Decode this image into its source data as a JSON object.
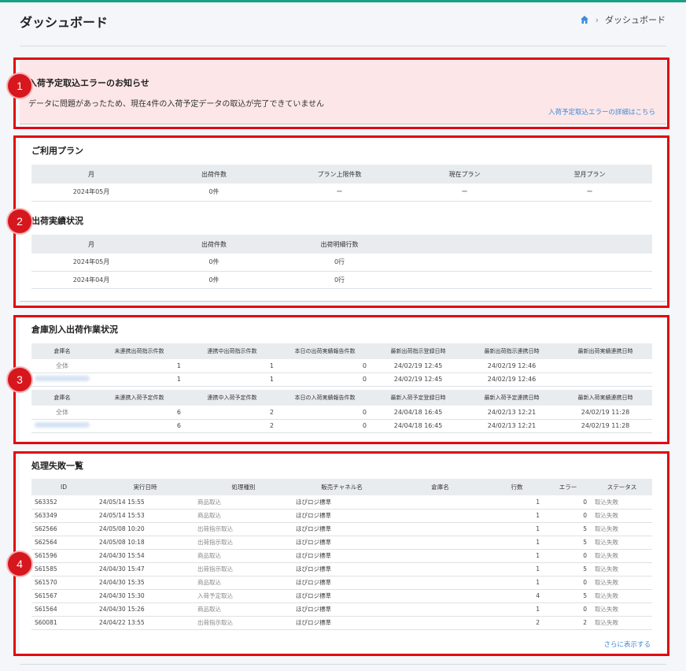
{
  "header": {
    "title": "ダッシュボード",
    "breadcrumb_sep": "›",
    "breadcrumb_current": "ダッシュボード"
  },
  "markers": [
    "1",
    "2",
    "3",
    "4"
  ],
  "alert": {
    "title": "入荷予定取込エラーのお知らせ",
    "message": "データに問題があったため、現在4件の入荷予定データの取込が完了できていません",
    "link": "入荷予定取込エラーの詳細はこちら"
  },
  "plan": {
    "title": "ご利用プラン",
    "headers": [
      "月",
      "出荷件数",
      "プラン上限件数",
      "現在プラン",
      "翌月プラン"
    ],
    "rows": [
      [
        "2024年05月",
        "0件",
        "ー",
        "ー",
        "ー"
      ]
    ]
  },
  "shipment": {
    "title": "出荷実績状況",
    "headers": [
      "月",
      "出荷件数",
      "出荷明細行数"
    ],
    "rows": [
      [
        "2024年05月",
        "0件",
        "0行"
      ],
      [
        "2024年04月",
        "0件",
        "0行"
      ]
    ]
  },
  "warehouse": {
    "title": "倉庫別入出荷作業状況",
    "out_headers": [
      "倉庫名",
      "未連携出荷指示件数",
      "連携中出荷指示件数",
      "本日の出荷実績報告件数",
      "最新出荷指示登録日時",
      "最新出荷指示連携日時",
      "最新出荷実績連携日時"
    ],
    "out_rows": [
      [
        "全体",
        "1",
        "1",
        "0",
        "24/02/19 12:45",
        "24/02/19 12:46",
        ""
      ],
      [
        "",
        "1",
        "1",
        "0",
        "24/02/19 12:45",
        "24/02/19 12:46",
        ""
      ]
    ],
    "in_headers": [
      "倉庫名",
      "未連携入荷予定件数",
      "連携中入荷予定件数",
      "本日の入荷実績報告件数",
      "最新入荷予定登録日時",
      "最新入荷予定連携日時",
      "最新入荷実績連携日時"
    ],
    "in_rows": [
      [
        "全体",
        "6",
        "2",
        "0",
        "24/04/18 16:45",
        "24/02/13 12:21",
        "24/02/19 11:28"
      ],
      [
        "",
        "6",
        "2",
        "0",
        "24/04/18 16:45",
        "24/02/13 12:21",
        "24/02/19 11:28"
      ]
    ]
  },
  "failures": {
    "title": "処理失敗一覧",
    "headers": [
      "ID",
      "実行日時",
      "処理種別",
      "販売チャネル名",
      "倉庫名",
      "行数",
      "エラー",
      "ステータス"
    ],
    "rows": [
      [
        "S63352",
        "24/05/14 15:55",
        "商品取込",
        "ほぴロジ標準",
        "",
        "1",
        "0",
        "取込失敗"
      ],
      [
        "S63349",
        "24/05/14 15:53",
        "商品取込",
        "ほぴロジ標準",
        "",
        "1",
        "0",
        "取込失敗"
      ],
      [
        "S62566",
        "24/05/08 10:20",
        "出荷指示取込",
        "ほぴロジ標準",
        "",
        "1",
        "5",
        "取込失敗"
      ],
      [
        "S62564",
        "24/05/08 10:18",
        "出荷指示取込",
        "ほぴロジ標準",
        "",
        "1",
        "5",
        "取込失敗"
      ],
      [
        "S61596",
        "24/04/30 15:54",
        "商品取込",
        "ほぴロジ標準",
        "",
        "1",
        "0",
        "取込失敗"
      ],
      [
        "S61585",
        "24/04/30 15:47",
        "出荷指示取込",
        "ほぴロジ標準",
        "",
        "1",
        "5",
        "取込失敗"
      ],
      [
        "S61570",
        "24/04/30 15:35",
        "商品取込",
        "ほぴロジ標準",
        "",
        "1",
        "0",
        "取込失敗"
      ],
      [
        "S61567",
        "24/04/30 15:30",
        "入荷予定取込",
        "ほぴロジ標準",
        "",
        "4",
        "5",
        "取込失敗"
      ],
      [
        "S61564",
        "24/04/30 15:26",
        "商品取込",
        "ほぴロジ標準",
        "",
        "1",
        "0",
        "取込失敗"
      ],
      [
        "S60081",
        "24/04/22 13:55",
        "出荷指示取込",
        "ほぴロジ標準",
        "",
        "2",
        "2",
        "取込失敗"
      ]
    ],
    "more": "さらに表示する"
  }
}
